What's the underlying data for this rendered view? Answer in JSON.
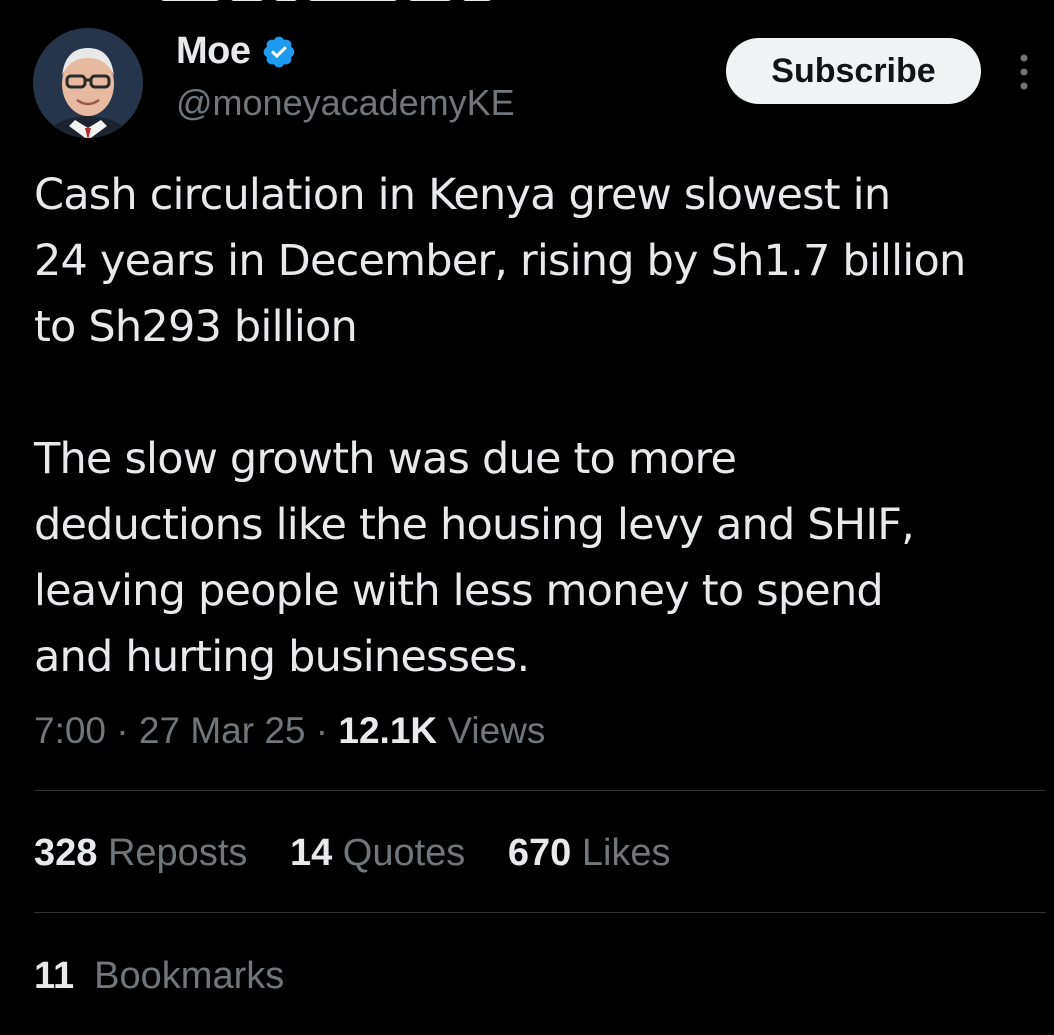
{
  "colors": {
    "background": "#000000",
    "text_primary": "#e7e9ea",
    "text_secondary": "#71767b",
    "verified_blue": "#1d9bf0",
    "divider": "#2f3336",
    "button_bg": "#eff3f4",
    "button_text": "#0f1419"
  },
  "author": {
    "display_name": "Moe",
    "handle": "@moneyacademyKE",
    "verified_icon": "verified-badge-icon",
    "avatar_icon": "profile-photo"
  },
  "header": {
    "subscribe_label": "Subscribe",
    "more_icon": "more-options-icon"
  },
  "tweet": {
    "paragraphs": [
      [
        "Cash circulation in Kenya grew slowest in",
        "24 years in December, rising by Sh1.7 billion",
        "to Sh293 billion"
      ],
      [
        "The slow growth was due to more",
        "deductions like the housing levy and SHIF,",
        "leaving people with less money to spend",
        "and hurting businesses."
      ]
    ]
  },
  "meta": {
    "time": "7:00",
    "separator": "·",
    "date": "27 Mar 25",
    "views_count": "12.1K",
    "views_label": "Views"
  },
  "stats": {
    "reposts_count": "328",
    "reposts_label": "Reposts",
    "quotes_count": "14",
    "quotes_label": "Quotes",
    "likes_count": "670",
    "likes_label": "Likes"
  },
  "bookmarks": {
    "count": "11",
    "label": "Bookmarks"
  }
}
